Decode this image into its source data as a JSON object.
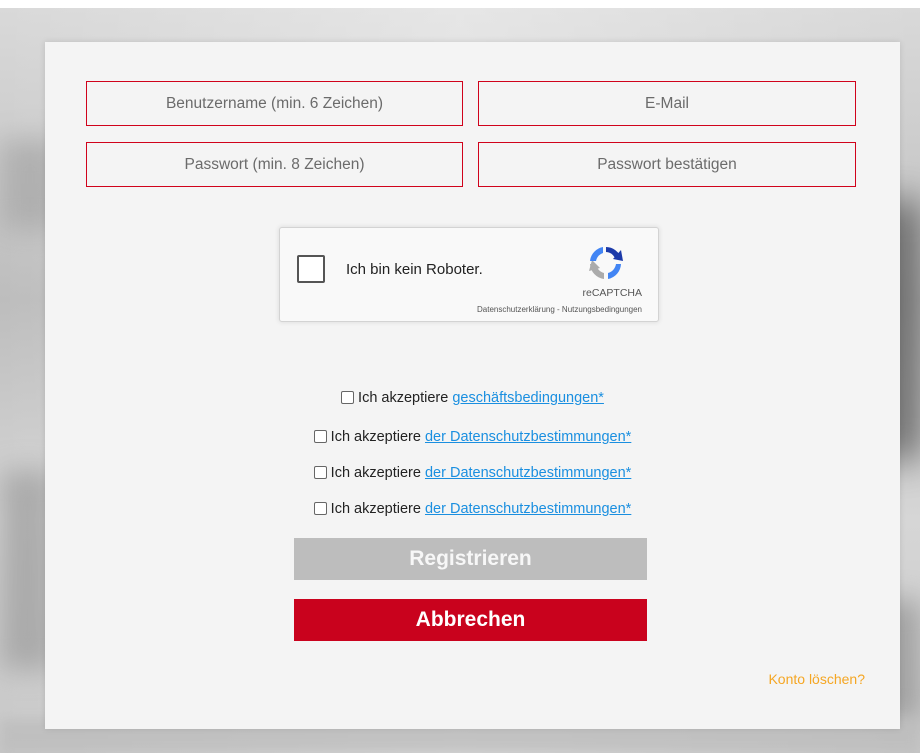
{
  "form": {
    "username_placeholder": "Benutzername (min. 6 Zeichen)",
    "email_placeholder": "E-Mail",
    "password_placeholder": "Passwort (min. 8 Zeichen)",
    "password_confirm_placeholder": "Passwort bestätigen"
  },
  "recaptcha": {
    "label": "Ich bin kein Roboter.",
    "brand": "reCAPTCHA",
    "links": "Datenschutzerklärung - Nutzungsbedingungen"
  },
  "consents": [
    {
      "prefix": "Ich akzeptiere ",
      "link": "geschäftsbedingungen*"
    },
    {
      "prefix": "Ich akzeptiere ",
      "link": "der Datenschutzbestimmungen*"
    },
    {
      "prefix": "Ich akzeptiere ",
      "link": "der Datenschutzbestimmungen*"
    },
    {
      "prefix": "Ich akzeptiere ",
      "link": "der Datenschutzbestimmungen*"
    }
  ],
  "buttons": {
    "register": "Registrieren",
    "cancel": "Abbrechen"
  },
  "delete_account_link": "Konto löschen?",
  "colors": {
    "accent_red": "#d0021b",
    "cancel_button": "#c9021d",
    "register_button_disabled": "#bdbdbd",
    "link_blue": "#1a8fe0",
    "delete_link_orange": "#f5a623"
  }
}
